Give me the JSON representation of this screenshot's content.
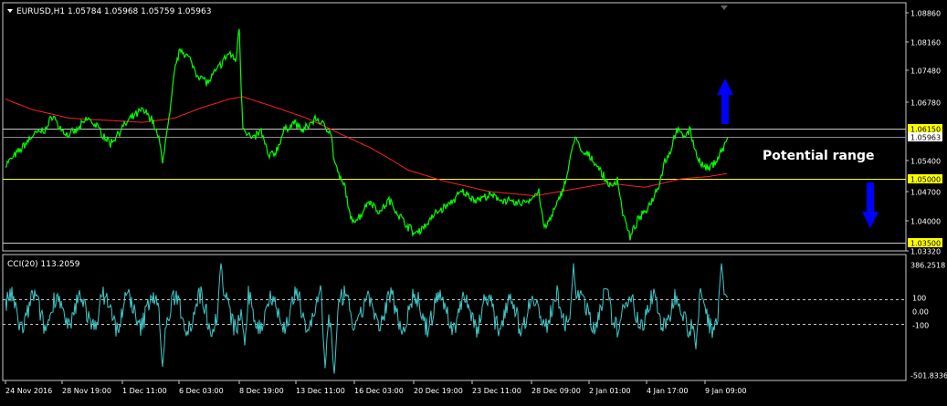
{
  "chart_data": [
    {
      "type": "line",
      "title": "EURUSD,H1  1.05784 1.05968 1.05759 1.05963",
      "header": {
        "symbol": "EURUSD,H1",
        "open": "1.05784",
        "high": "1.05968",
        "low": "1.05759",
        "close": "1.05963"
      },
      "x_labels": [
        "24 Nov 2016",
        "28 Nov 19:00",
        "1 Dec 11:00",
        "6 Dec 03:00",
        "8 Dec 19:00",
        "13 Dec 11:00",
        "16 Dec 03:00",
        "20 Dec 19:00",
        "23 Dec 11:00",
        "28 Dec 09:00",
        "2 Jan 01:00",
        "4 Jan 17:00",
        "9 Jan 09:00"
      ],
      "y_ticks": [
        "1.08860",
        "1.08160",
        "1.07480",
        "1.06780",
        "1.06150",
        "1.05963",
        "1.05400",
        "1.05000",
        "1.04700",
        "1.04000",
        "1.03500",
        "1.03320"
      ],
      "ylim": [
        1.0332,
        1.0886
      ],
      "highlighted_levels": [
        {
          "label": "1.06150",
          "value": 1.0615,
          "line_color": "#c8c8c8",
          "box_color": "#ffff00"
        },
        {
          "label": "1.05000",
          "value": 1.05,
          "line_color": "#ffff00",
          "box_color": "#ffff00"
        },
        {
          "label": "1.03500",
          "value": 1.035,
          "line_color": "#c8c8c8",
          "box_color": "#ffff00"
        }
      ],
      "current_price": {
        "label": "1.05963",
        "value": 1.05963
      },
      "series": [
        {
          "role": "price",
          "color": "#00ff00",
          "anchors": [
            [
              0,
              1.053
            ],
            [
              14,
              1.056
            ],
            [
              30,
              1.06
            ],
            [
              45,
              1.0615
            ],
            [
              52,
              1.065
            ],
            [
              58,
              1.062
            ],
            [
              68,
              1.06
            ],
            [
              78,
              1.061
            ],
            [
              90,
              1.064
            ],
            [
              100,
              1.062
            ],
            [
              115,
              1.058
            ],
            [
              125,
              1.061
            ],
            [
              138,
              1.064
            ],
            [
              150,
              1.066
            ],
            [
              160,
              1.064
            ],
            [
              168,
              1.059
            ],
            [
              172,
              1.054
            ],
            [
              180,
              1.065
            ],
            [
              186,
              1.076
            ],
            [
              192,
              1.08
            ],
            [
              200,
              1.078
            ],
            [
              210,
              1.074
            ],
            [
              222,
              1.072
            ],
            [
              235,
              1.076
            ],
            [
              245,
              1.079
            ],
            [
              252,
              1.077
            ],
            [
              256,
              1.085
            ],
            [
              258,
              1.072
            ],
            [
              260,
              1.062
            ],
            [
              270,
              1.059
            ],
            [
              280,
              1.061
            ],
            [
              288,
              1.055
            ],
            [
              296,
              1.056
            ],
            [
              305,
              1.061
            ],
            [
              316,
              1.063
            ],
            [
              326,
              1.061
            ],
            [
              340,
              1.064
            ],
            [
              350,
              1.062
            ],
            [
              356,
              1.061
            ],
            [
              360,
              1.054
            ],
            [
              366,
              1.05
            ],
            [
              372,
              1.048
            ],
            [
              378,
              1.04
            ],
            [
              388,
              1.041
            ],
            [
              398,
              1.045
            ],
            [
              410,
              1.042
            ],
            [
              420,
              1.045
            ],
            [
              432,
              1.041
            ],
            [
              440,
              1.039
            ],
            [
              448,
              1.037
            ],
            [
              460,
              1.039
            ],
            [
              472,
              1.042
            ],
            [
              486,
              1.044
            ],
            [
              500,
              1.047
            ],
            [
              515,
              1.045
            ],
            [
              530,
              1.046
            ],
            [
              545,
              1.045
            ],
            [
              560,
              1.044
            ],
            [
              574,
              1.045
            ],
            [
              584,
              1.047
            ],
            [
              590,
              1.038
            ],
            [
              598,
              1.041
            ],
            [
              606,
              1.045
            ],
            [
              614,
              1.05
            ],
            [
              620,
              1.056
            ],
            [
              624,
              1.06
            ],
            [
              630,
              1.056
            ],
            [
              640,
              1.055
            ],
            [
              648,
              1.053
            ],
            [
              656,
              1.05
            ],
            [
              664,
              1.048
            ],
            [
              670,
              1.05
            ],
            [
              676,
              1.042
            ],
            [
              684,
              1.036
            ],
            [
              692,
              1.04
            ],
            [
              700,
              1.042
            ],
            [
              708,
              1.045
            ],
            [
              716,
              1.049
            ],
            [
              722,
              1.054
            ],
            [
              728,
              1.056
            ],
            [
              734,
              1.061
            ],
            [
              742,
              1.06
            ],
            [
              750,
              1.061
            ],
            [
              756,
              1.056
            ],
            [
              762,
              1.053
            ],
            [
              770,
              1.052
            ],
            [
              778,
              1.054
            ],
            [
              786,
              1.057
            ],
            [
              791,
              1.0596
            ]
          ]
        },
        {
          "role": "moving-average",
          "color": "#ff2020",
          "anchors": [
            [
              0,
              1.0685
            ],
            [
              30,
              1.066
            ],
            [
              70,
              1.064
            ],
            [
              110,
              1.0635
            ],
            [
              150,
              1.063
            ],
            [
              185,
              1.064
            ],
            [
              215,
              1.0665
            ],
            [
              245,
              1.0685
            ],
            [
              260,
              1.069
            ],
            [
              290,
              1.067
            ],
            [
              330,
              1.064
            ],
            [
              360,
              1.061
            ],
            [
              400,
              1.057
            ],
            [
              440,
              1.052
            ],
            [
              480,
              1.0495
            ],
            [
              530,
              1.047
            ],
            [
              580,
              1.046
            ],
            [
              620,
              1.0475
            ],
            [
              660,
              1.049
            ],
            [
              700,
              1.048
            ],
            [
              740,
              1.05
            ],
            [
              770,
              1.0505
            ],
            [
              791,
              1.0512
            ]
          ]
        }
      ],
      "annotations": [
        {
          "text": "Potential range",
          "color": "#ffffff"
        },
        {
          "shape": "up-arrow",
          "color": "#0000ff"
        },
        {
          "shape": "down-arrow",
          "color": "#0000ff"
        }
      ]
    },
    {
      "type": "line",
      "title": "CCI(20) 113.2059",
      "ylim": [
        -501.8336,
        386.2518
      ],
      "y_ticks": [
        "386.2518",
        "100",
        "0.00",
        "-100",
        "-501.8336"
      ],
      "reference_levels": [
        100,
        -100
      ],
      "series": [
        {
          "role": "cci",
          "color": "#40c8c8",
          "last_value": 113.2059
        }
      ]
    }
  ]
}
